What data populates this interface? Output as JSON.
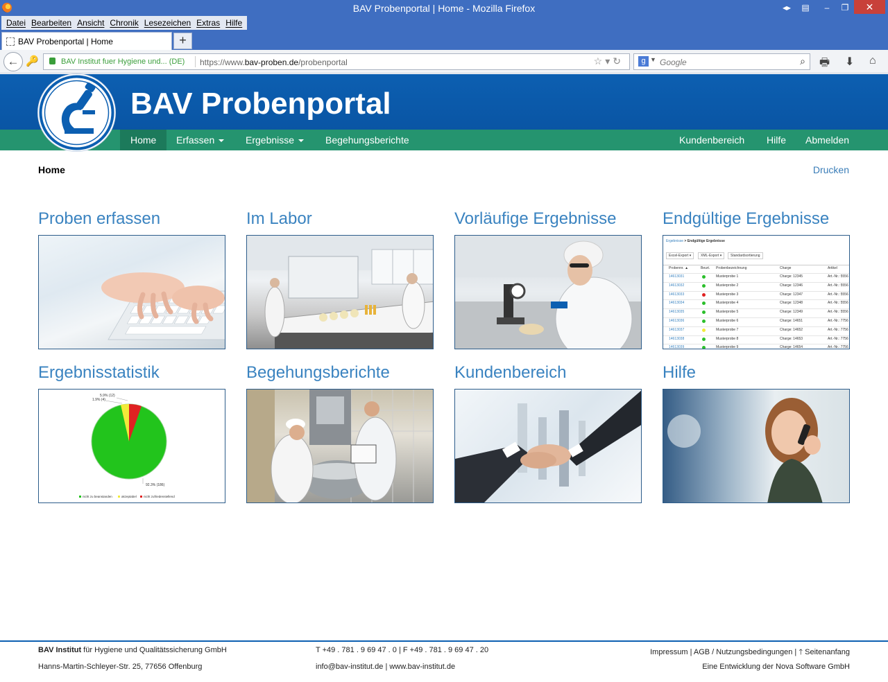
{
  "browser": {
    "window_title": "BAV Probenportal | Home - Mozilla Firefox",
    "menu": [
      "Datei",
      "Bearbeiten",
      "Ansicht",
      "Chronik",
      "Lesezeichen",
      "Extras",
      "Hilfe"
    ],
    "tab_label": "BAV Probenportal | Home",
    "identity": "BAV Institut fuer Hygiene und... (DE)",
    "url_prefix": "https://www.",
    "url_domain": "bav-proben.de",
    "url_path": "/probenportal",
    "search_placeholder": "Google"
  },
  "site": {
    "brand": "BAV Probenportal",
    "nav_left": [
      "Home",
      "Erfassen",
      "Ergebnisse",
      "Begehungsberichte"
    ],
    "nav_right": [
      "Kundenbereich",
      "Hilfe",
      "Abmelden"
    ],
    "breadcrumb": "Home",
    "print": "Drucken"
  },
  "tiles": [
    {
      "title": "Proben erfassen",
      "image": "keyboard-typing"
    },
    {
      "title": "Im Labor",
      "image": "laboratory"
    },
    {
      "title": "Vorläufige Ergebnisse",
      "image": "microscope-lab-worker"
    },
    {
      "title": "Endgültige Ergebnisse",
      "image": "results-table-screenshot"
    },
    {
      "title": "Ergebnisstatistik",
      "image": "pie-chart"
    },
    {
      "title": "Begehungsberichte",
      "image": "kitchen-inspection"
    },
    {
      "title": "Kundenbereich",
      "image": "handshake"
    },
    {
      "title": "Hilfe",
      "image": "woman-on-phone"
    }
  ],
  "results_preview": {
    "crumb_link": "Ergebnisse",
    "crumb_current": "Endgültige Ergebnisse",
    "buttons": [
      "Excel-Export ▾",
      "XML-Export ▾",
      "Standardsortierung"
    ],
    "headers": [
      "Probennr. ▲",
      "Beurt.",
      "Probenbezeichnung",
      "Charge",
      "Artikel"
    ],
    "rows": [
      [
        "14613031",
        "green",
        "Musterprobe 1",
        "Charge: 12345",
        "Art.-Nr.: 5556"
      ],
      [
        "14613032",
        "green",
        "Musterprobe 2",
        "Charge: 12346",
        "Art.-Nr.: 5556"
      ],
      [
        "14613033",
        "red",
        "Musterprobe 3",
        "Charge: 12347",
        "Art.-Nr.: 5556"
      ],
      [
        "14613034",
        "green",
        "Musterprobe 4",
        "Charge: 12348",
        "Art.-Nr.: 5556"
      ],
      [
        "14613035",
        "green",
        "Musterprobe 5",
        "Charge: 12349",
        "Art.-Nr.: 5556"
      ],
      [
        "14613036",
        "green",
        "Musterprobe 6",
        "Charge: 14651",
        "Art.-Nr.: 7756"
      ],
      [
        "14613037",
        "yellow",
        "Musterprobe 7",
        "Charge: 14652",
        "Art.-Nr.: 7756"
      ],
      [
        "14613038",
        "green",
        "Musterprobe 8",
        "Charge: 14653",
        "Art.-Nr.: 7756"
      ],
      [
        "14613039",
        "green",
        "Musterprobe 9",
        "Charge: 14654",
        "Art.-Nr.: 7756"
      ]
    ]
  },
  "stats_preview": {
    "labels": [
      "5.9% (12)",
      "1.9% (4)",
      "92.3% (186)"
    ],
    "legend": [
      "nicht zu beanstanden",
      "akzeptabel",
      "nicht zufriedenstellend"
    ],
    "colors": {
      "green": "#22c41c",
      "yellow": "#f2ea3a",
      "red": "#e02222"
    }
  },
  "footer": {
    "company_bold": "BAV Institut",
    "company_rest": " für Hygiene und Qualitätssicherung GmbH",
    "address": "Hanns-Martin-Schleyer-Str. 25, 77656 Offenburg",
    "phone": "T +49 . 781 . 9 69 47 . 0 | F +49 . 781 . 9 69 47 . 20",
    "email": "info@bav-institut.de | www.bav-institut.de",
    "links": "Impressum | AGB / Nutzungsbedingungen | ",
    "top_link": "Seitenanfang",
    "credit": "Eine Entwicklung der Nova Software GmbH"
  },
  "colors": {
    "header_blue": "#0c5fb1",
    "nav_green": "#25946f",
    "link_blue": "#3a83c0"
  }
}
